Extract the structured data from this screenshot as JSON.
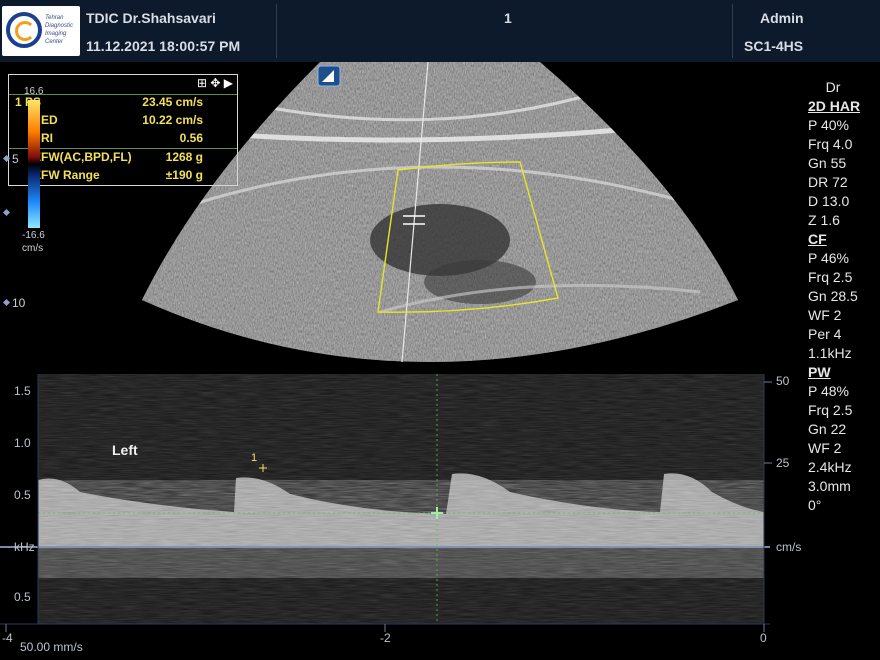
{
  "header": {
    "logo_text": "Tehran Diagnostic Imaging Center",
    "facility": "TDIC Dr.Shahsavari",
    "datetime": "11.12.2021   18:00:57 PM",
    "page_number": "1",
    "user": "Admin",
    "probe": "SC1-4HS"
  },
  "measurements": {
    "rows": [
      {
        "label": "1  PS",
        "value": "23.45 cm/s"
      },
      {
        "label": "ED",
        "value": "10.22 cm/s"
      },
      {
        "label": "RI",
        "value": "0.56"
      },
      {
        "label": "EFW(AC,BPD,FL)",
        "value": "1268 g"
      },
      {
        "label": "EFW Range",
        "value": "±190 g"
      }
    ]
  },
  "colorbar": {
    "max": "16.6",
    "min": "-16.6",
    "unit": "cm/s"
  },
  "depth_labels": [
    "5",
    "10"
  ],
  "params": {
    "mode_user": "Dr",
    "sections": [
      {
        "head": "2D HAR",
        "items": [
          "P 40%",
          "Frq 4.0",
          "Gn 55",
          "DR 72",
          "D 13.0",
          "Z 1.6"
        ]
      },
      {
        "head": "CF",
        "items": [
          "P 46%",
          "Frq 2.5",
          "Gn 28.5",
          "WF 2",
          "Per 4",
          "1.1kHz"
        ]
      },
      {
        "head": "PW",
        "items": [
          "P 48%",
          "Frq 2.5",
          "Gn 22",
          "WF 2",
          "2.4kHz",
          "3.0mm",
          "0°"
        ]
      }
    ]
  },
  "doppler": {
    "side_label": "Left",
    "cursor_label": "1",
    "left_axis": [
      "1.5",
      "1.0",
      "0.5",
      "kHz",
      "0.5"
    ],
    "right_axis": [
      "50",
      "25",
      "cm/s"
    ],
    "time_axis": [
      "-4",
      "-2",
      "0"
    ],
    "sweep_speed": "50.00 mm/s"
  },
  "colors": {
    "caliper": "#f5e05a",
    "roi": "#e6e62a",
    "baseline": "#9db7e0"
  }
}
